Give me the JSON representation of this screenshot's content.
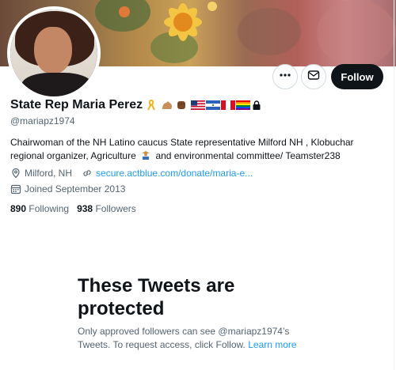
{
  "profile": {
    "name": "State Rep Maria Perez",
    "handle": "@mariapz1974",
    "emojis": [
      "awareness-ribbon",
      "flexed-biceps",
      "raised-fist",
      "us-flag",
      "nicaragua-flag",
      "peru-flag",
      "rainbow-flag",
      "lock"
    ],
    "bio_line1": "Chairwoman of the NH Latino caucus State representative Milford NH , Klobuchar",
    "bio_line2_before": "regional organizer, Agriculture",
    "bio_line2_after": "and environmental committee/ Teamster238",
    "location": "Milford, NH",
    "website": "secure.actblue.com/donate/maria-e...",
    "joined": "Joined September 2013",
    "following_count": "890",
    "following_label": "Following",
    "followers_count": "938",
    "followers_label": "Followers"
  },
  "actions": {
    "more_icon": "more-icon",
    "message_icon": "envelope-icon",
    "follow_label": "Follow"
  },
  "protected": {
    "title": "These Tweets are protected",
    "desc": "Only approved followers can see @mariapz1974’s Tweets. To request access, click Follow.",
    "learn_more": "Learn more"
  },
  "colors": {
    "accent": "#1d9bf0",
    "text": "#0f1419",
    "muted": "#536471",
    "follow_bg": "#0f1419"
  }
}
